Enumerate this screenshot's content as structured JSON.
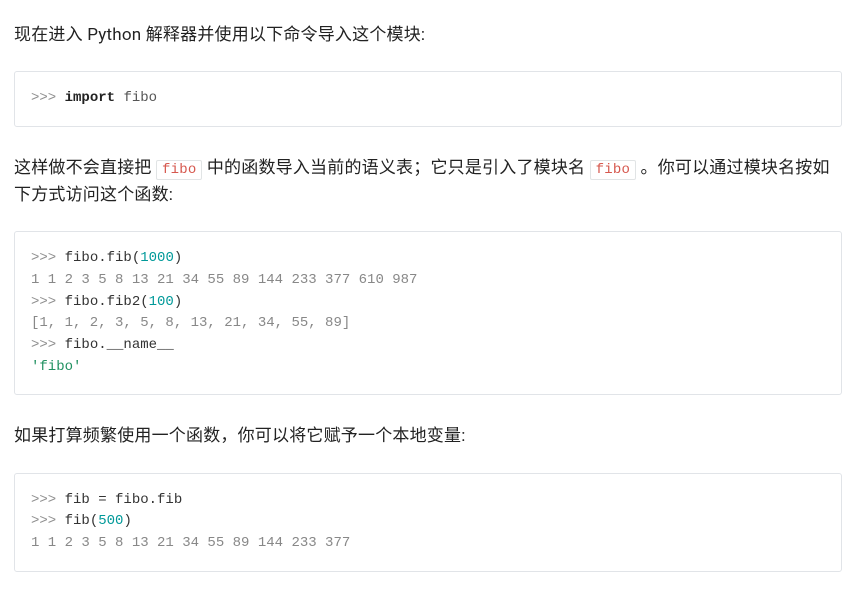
{
  "paragraphs": {
    "p1": "现在进入 Python 解释器并使用以下命令导入这个模块:",
    "p2_a": "这样做不会直接把 ",
    "p2_code1": "fibo",
    "p2_b": " 中的函数导入当前的语义表；它只是引入了模块名 ",
    "p2_code2": "fibo",
    "p2_c": " 。你可以通过模块名按如下方式访问这个函数:",
    "p3": "如果打算频繁使用一个函数，你可以将它赋予一个本地变量:"
  },
  "code": {
    "c1": {
      "l1_prompt": ">>> ",
      "l1_kw": "import",
      "l1_sp": " ",
      "l1_nn": "fibo"
    },
    "c2": {
      "l1_prompt": ">>> ",
      "l1_call_a": "fibo.fib(",
      "l1_num": "1000",
      "l1_call_b": ")",
      "l2_out": "1 1 2 3 5 8 13 21 34 55 89 144 233 377 610 987",
      "l3_prompt": ">>> ",
      "l3_call_a": "fibo.fib2(",
      "l3_num": "100",
      "l3_call_b": ")",
      "l4_out": "[1, 1, 2, 3, 5, 8, 13, 21, 34, 55, 89]",
      "l5_prompt": ">>> ",
      "l5_call": "fibo.__name__",
      "l6_str": "'fibo'"
    },
    "c3": {
      "l1_prompt": ">>> ",
      "l1_body": "fib = fibo.fib",
      "l2_prompt": ">>> ",
      "l2_call_a": "fib(",
      "l2_num": "500",
      "l2_call_b": ")",
      "l3_out": "1 1 2 3 5 8 13 21 34 55 89 144 233 377"
    }
  }
}
